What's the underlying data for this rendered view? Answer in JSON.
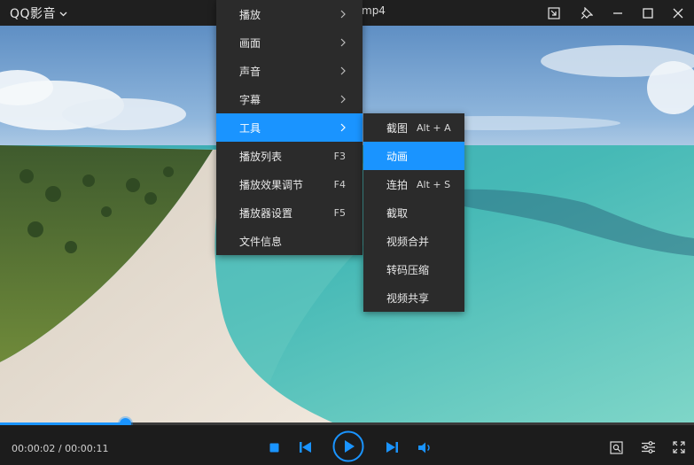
{
  "titlebar": {
    "app_name": "QQ影音",
    "file_name": "mp4"
  },
  "main_menu": {
    "items": [
      {
        "label": "播放",
        "has_submenu": true
      },
      {
        "label": "画面",
        "has_submenu": true
      },
      {
        "label": "声音",
        "has_submenu": true
      },
      {
        "label": "字幕",
        "has_submenu": true
      },
      {
        "label": "工具",
        "has_submenu": true,
        "active": true
      },
      {
        "label": "播放列表",
        "shortcut": "F3"
      },
      {
        "label": "播放效果调节",
        "shortcut": "F4"
      },
      {
        "label": "播放器设置",
        "shortcut": "F5"
      },
      {
        "label": "文件信息"
      }
    ]
  },
  "tools_submenu": {
    "items": [
      {
        "label": "截图",
        "shortcut": "Alt + A"
      },
      {
        "label": "动画",
        "active": true
      },
      {
        "label": "连拍",
        "shortcut": "Alt + S"
      },
      {
        "label": "截取"
      },
      {
        "label": "视频合并"
      },
      {
        "label": "转码压缩"
      },
      {
        "label": "视频共享"
      }
    ]
  },
  "player": {
    "current_time": "00:00:02",
    "total_time": "00:00:11",
    "time_display": "00:00:02 / 00:00:11",
    "progress_fraction": 0.18
  },
  "colors": {
    "accent": "#1a94ff",
    "menu_bg": "#2b2b2b",
    "bar_bg": "#1c1c1c"
  },
  "icons": {
    "window": [
      "mini-mode-icon",
      "pin-icon",
      "minimize-icon",
      "maximize-icon",
      "close-icon"
    ],
    "controls": [
      "stop-icon",
      "previous-icon",
      "play-icon",
      "next-icon",
      "volume-icon"
    ],
    "right_controls": [
      "screenshot-tool-icon",
      "settings-sliders-icon",
      "fullscreen-icon"
    ]
  }
}
